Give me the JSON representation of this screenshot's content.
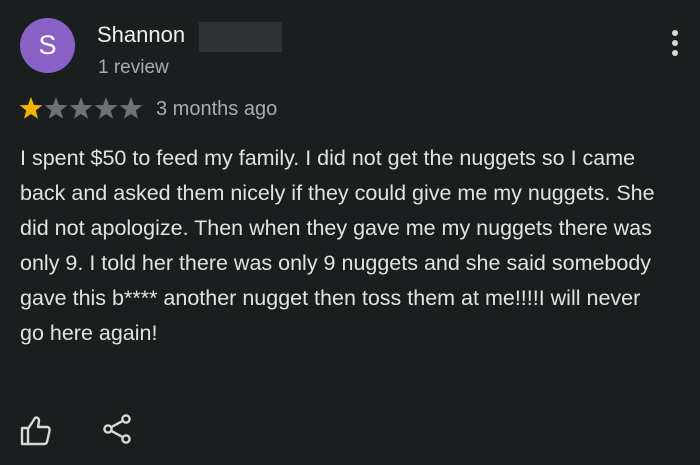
{
  "reviewer": {
    "avatar_letter": "S",
    "avatar_color": "#8a61c7",
    "name": "Shannon",
    "review_count": "1 review"
  },
  "review": {
    "rating": 1,
    "max_rating": 5,
    "star_filled_color": "#f4b400",
    "star_empty_color": "#6e7173",
    "date": "3 months ago",
    "text": "I spent $50 to feed my family. I did not get the nuggets so I came back and asked them nicely if they could give me my nuggets. She did not apologize. Then when they gave me my nuggets there was only 9. I told her there was only 9 nuggets and she said somebody gave this b**** another nugget then toss them at me!!!!I will never go here again!"
  },
  "actions": {
    "more_icon": "more-vert-icon",
    "like_icon": "thumbs-up-icon",
    "share_icon": "share-icon"
  }
}
